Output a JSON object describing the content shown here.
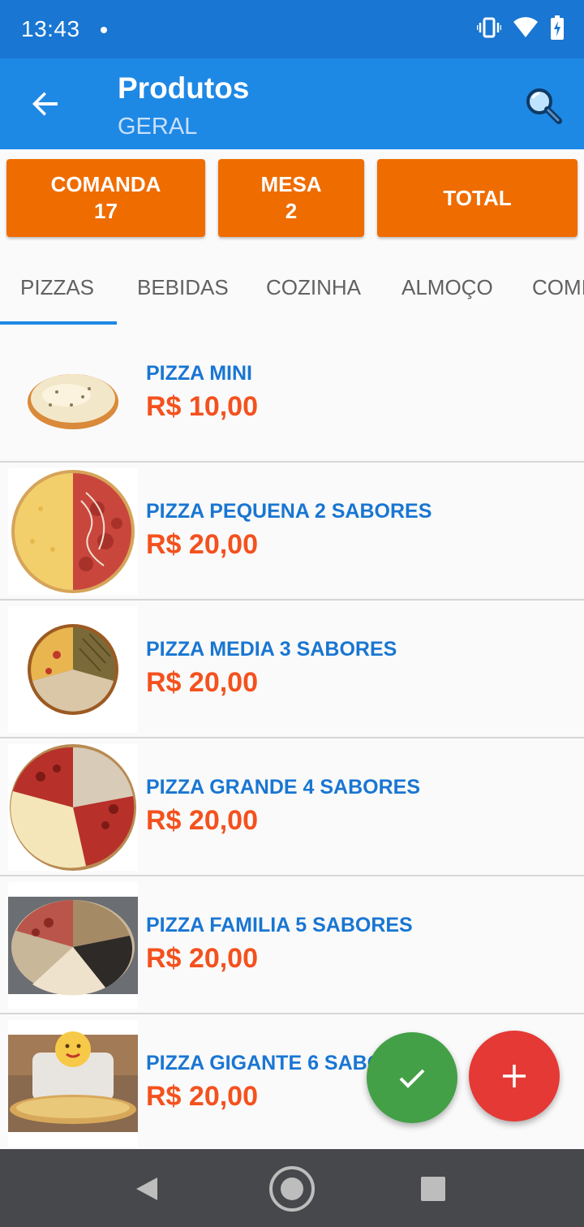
{
  "status_bar": {
    "time": "13:43",
    "icons": [
      "vibrate-icon",
      "wifi-icon",
      "battery-charging-icon"
    ]
  },
  "app_bar": {
    "title": "Produtos",
    "subtitle": "GERAL",
    "back_icon": "arrow-back-icon",
    "search_icon": "search-icon"
  },
  "info": {
    "comanda": {
      "label": "COMANDA",
      "value": "17"
    },
    "mesa": {
      "label": "MESA",
      "value": "2"
    },
    "total": {
      "label": "TOTAL"
    }
  },
  "tabs": [
    {
      "label": "PIZZAS",
      "selected": true
    },
    {
      "label": "BEBIDAS"
    },
    {
      "label": "COZINHA"
    },
    {
      "label": "ALMOÇO"
    },
    {
      "label": "COMIDAS"
    }
  ],
  "products": [
    {
      "name": "PIZZA MINI",
      "price": "R$ 10,00"
    },
    {
      "name": "PIZZA PEQUENA 2 SABORES",
      "price": "R$ 20,00"
    },
    {
      "name": "PIZZA MEDIA 3 SABORES",
      "price": "R$ 20,00"
    },
    {
      "name": "PIZZA GRANDE 4 SABORES",
      "price": "R$ 20,00"
    },
    {
      "name": "PIZZA FAMILIA 5 SABORES",
      "price": "R$ 20,00"
    },
    {
      "name": "PIZZA GIGANTE 6 SABORES",
      "price": "R$ 20,00"
    }
  ],
  "fabs": {
    "confirm_icon": "check-icon",
    "add_icon": "plus-icon"
  },
  "nav_bar": [
    "nav-back-icon",
    "nav-home-icon",
    "nav-recents-icon"
  ],
  "colors": {
    "primary": "#1e88e5",
    "status_bar": "#1976d2",
    "accent_orange": "#ef6c00",
    "price": "#f4511e",
    "confirm": "#43a047",
    "add": "#e53935"
  }
}
